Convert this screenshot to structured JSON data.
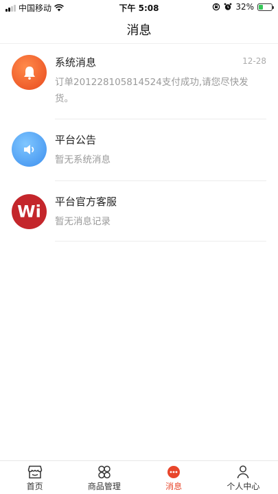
{
  "status_bar": {
    "carrier": "中国移动",
    "time": "下午 5:08",
    "battery_percent": "32%",
    "battery_level": 0.32
  },
  "header": {
    "title": "消息"
  },
  "messages": [
    {
      "title": "系统消息",
      "preview": "订单201228105814524支付成功,请您尽快发货。",
      "time": "12-28",
      "icon": "bell-icon",
      "color": "#f0602a"
    },
    {
      "title": "平台公告",
      "preview": "暂无系统消息",
      "time": "",
      "icon": "speaker-icon",
      "color": "#4d9ff2"
    },
    {
      "title": "平台官方客服",
      "preview": "暂无消息记录",
      "time": "",
      "icon": "wi-logo",
      "logo_text": "Wi",
      "color": "#c4262b"
    }
  ],
  "tabs": [
    {
      "label": "首页",
      "icon": "store-icon",
      "active": false
    },
    {
      "label": "商品管理",
      "icon": "grid-icon",
      "active": false
    },
    {
      "label": "消息",
      "icon": "chat-bubble-icon",
      "active": true
    },
    {
      "label": "个人中心",
      "icon": "person-icon",
      "active": false
    }
  ],
  "colors": {
    "accent": "#e8452a",
    "text_secondary": "#9a9a9a"
  }
}
